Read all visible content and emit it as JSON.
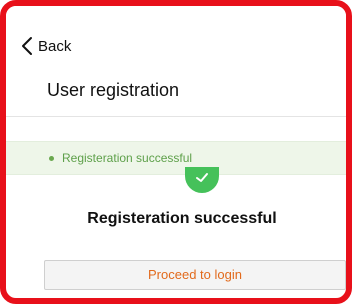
{
  "nav": {
    "back_label": "Back"
  },
  "page": {
    "title": "User registration"
  },
  "alert": {
    "message": "Registeration successful",
    "color": "#5ea04a",
    "background": "#eef6e9"
  },
  "result": {
    "icon": "check-circle-icon",
    "title": "Registeration successful",
    "icon_color": "#45c15a"
  },
  "actions": {
    "proceed_label": "Proceed to login",
    "proceed_color": "#e26a1c"
  },
  "frame": {
    "border_color": "#e8101a"
  }
}
